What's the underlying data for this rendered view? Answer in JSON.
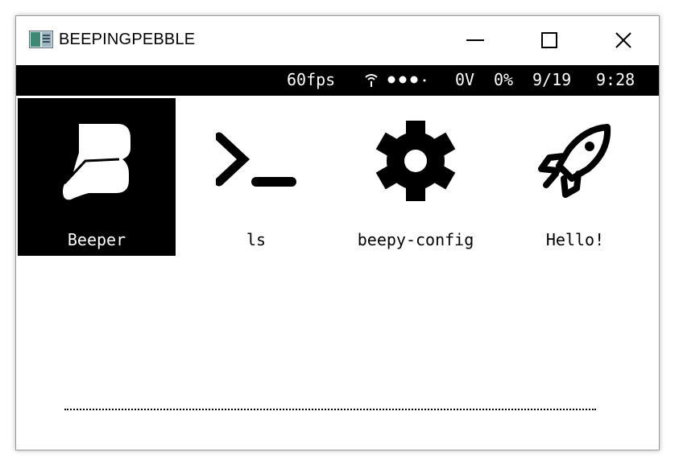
{
  "window": {
    "title": "BEEPINGPEBBLE",
    "controls": [
      "minimize",
      "maximize",
      "close"
    ]
  },
  "status_bar": {
    "fps": "60fps",
    "wifi_icon": "wifi-icon",
    "signal_icon": "signal-dots-icon",
    "voltage": "0V",
    "battery": "0%",
    "date": "9/19",
    "time": "9:28"
  },
  "apps": [
    {
      "label": "Beeper",
      "icon": "beeper-logo-icon",
      "selected": true
    },
    {
      "label": "ls",
      "icon": "terminal-prompt-icon",
      "selected": false
    },
    {
      "label": "beepy-config",
      "icon": "gear-icon",
      "selected": false
    },
    {
      "label": "Hello!",
      "icon": "rocket-icon",
      "selected": false
    }
  ],
  "colors": {
    "status_bg": "#000000",
    "status_fg": "#ffffff",
    "selected_bg": "#000000",
    "window_bg": "#ffffff"
  }
}
